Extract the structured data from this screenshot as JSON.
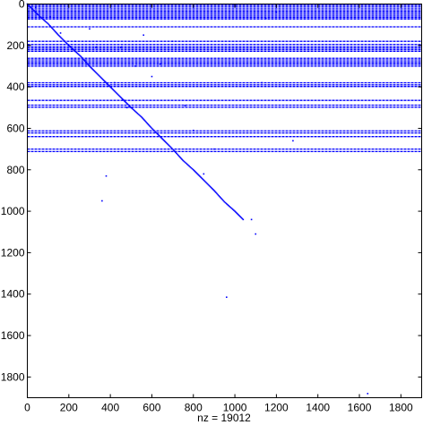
{
  "chart_data": {
    "type": "scatter",
    "title": "",
    "xlabel": "nz = 19012",
    "ylabel": "",
    "xlim": [
      0,
      1900
    ],
    "ylim": [
      0,
      1900
    ],
    "y_reversed": true,
    "grid": false,
    "marker_color": "#0000ff",
    "xticks": [
      "0",
      "200",
      "400",
      "600",
      "800",
      "1000",
      "1200",
      "1400",
      "1600",
      "1800"
    ],
    "yticks": [
      "0",
      "200",
      "400",
      "600",
      "800",
      "1000",
      "1200",
      "1400",
      "1600",
      "1800"
    ],
    "dense_rows": [
      5,
      12,
      20,
      28,
      35,
      42,
      50,
      58,
      65,
      72,
      110,
      180,
      195,
      205,
      212,
      220,
      228,
      262,
      270,
      278,
      285,
      292,
      300,
      380,
      390,
      398,
      465,
      488,
      498,
      612,
      622,
      640,
      700,
      712
    ],
    "diagonal": [
      [
        0,
        0
      ],
      [
        60,
        60
      ],
      [
        100,
        95
      ],
      [
        150,
        150
      ],
      [
        200,
        200
      ],
      [
        260,
        255
      ],
      [
        300,
        300
      ],
      [
        350,
        350
      ],
      [
        400,
        400
      ],
      [
        450,
        450
      ],
      [
        500,
        500
      ],
      [
        550,
        545
      ],
      [
        600,
        600
      ],
      [
        650,
        650
      ],
      [
        700,
        700
      ],
      [
        750,
        755
      ],
      [
        800,
        800
      ],
      [
        850,
        850
      ],
      [
        900,
        900
      ],
      [
        950,
        955
      ],
      [
        1000,
        1000
      ],
      [
        1040,
        1040
      ]
    ],
    "scattered_points": [
      [
        40,
        15
      ],
      [
        110,
        60
      ],
      [
        160,
        140
      ],
      [
        230,
        180
      ],
      [
        300,
        120
      ],
      [
        330,
        210
      ],
      [
        360,
        950
      ],
      [
        380,
        830
      ],
      [
        420,
        380
      ],
      [
        450,
        210
      ],
      [
        480,
        500
      ],
      [
        520,
        300
      ],
      [
        560,
        150
      ],
      [
        600,
        350
      ],
      [
        640,
        290
      ],
      [
        700,
        180
      ],
      [
        760,
        490
      ],
      [
        800,
        610
      ],
      [
        850,
        820
      ],
      [
        900,
        700
      ],
      [
        960,
        1415
      ],
      [
        1080,
        1040
      ],
      [
        1100,
        1110
      ],
      [
        1130,
        380
      ],
      [
        1150,
        70
      ],
      [
        1200,
        40
      ],
      [
        1280,
        660
      ],
      [
        1640,
        1880
      ]
    ]
  }
}
